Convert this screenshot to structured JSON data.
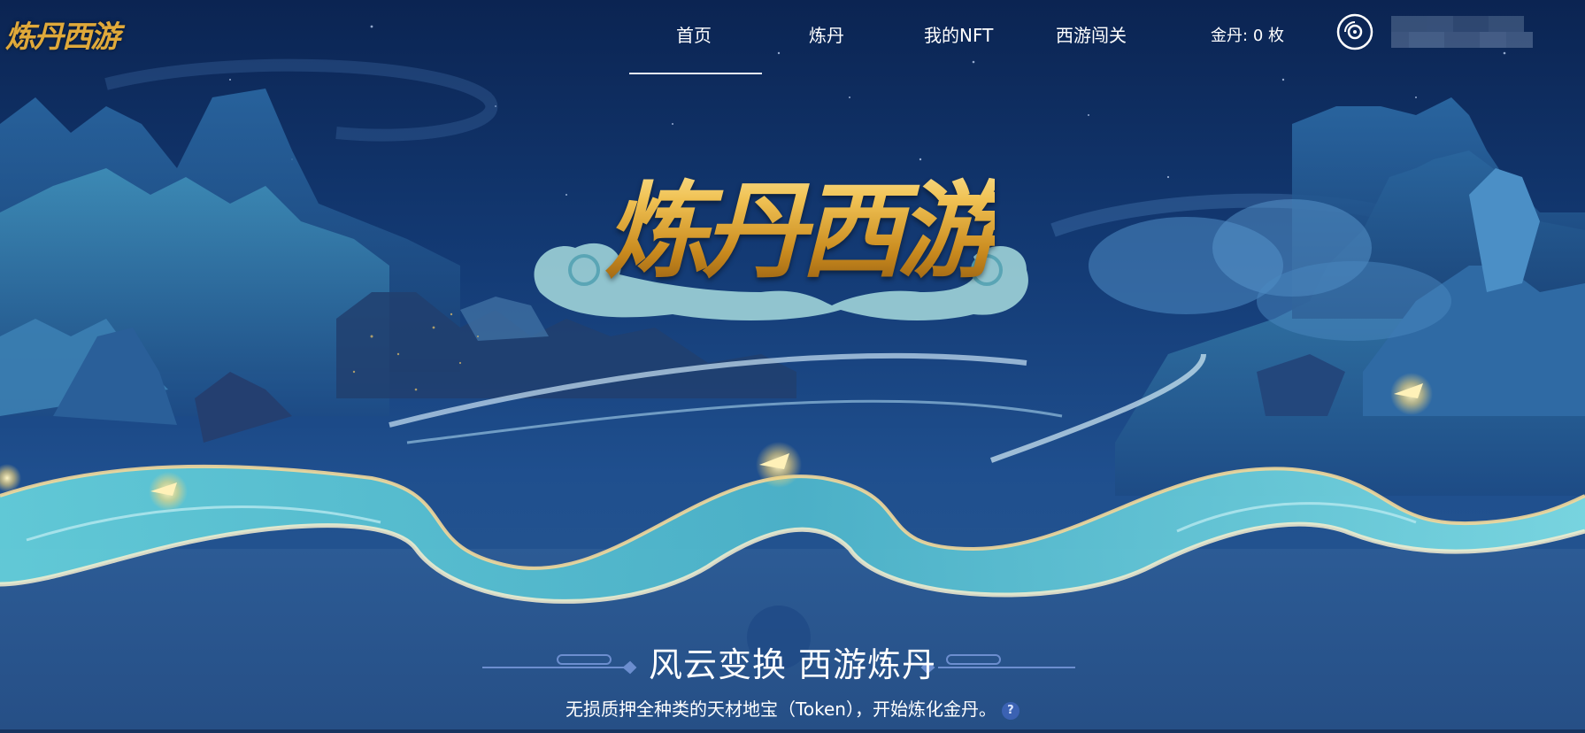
{
  "brand": {
    "logo_text": "炼丹西游",
    "hero_title": "炼丹西游"
  },
  "nav": {
    "items": [
      {
        "label": "首页",
        "active": true
      },
      {
        "label": "炼丹",
        "active": false
      },
      {
        "label": "我的NFT",
        "active": false
      },
      {
        "label": "西游闯关",
        "active": false
      }
    ]
  },
  "wallet": {
    "gold_label": "金丹:",
    "gold_value": "0",
    "gold_unit": "枚",
    "icon": "disc-icon"
  },
  "hero": {
    "slogan": "风云变换 西游炼丹",
    "description": "无损质押全种类的天材地宝（Token），开始炼化金丹。",
    "help_label": "?"
  },
  "colors": {
    "background": "#17345f",
    "accent_gold": "#e0a93a",
    "river_teal": "#5cc7d3",
    "help_badge": "#3b62b3"
  }
}
